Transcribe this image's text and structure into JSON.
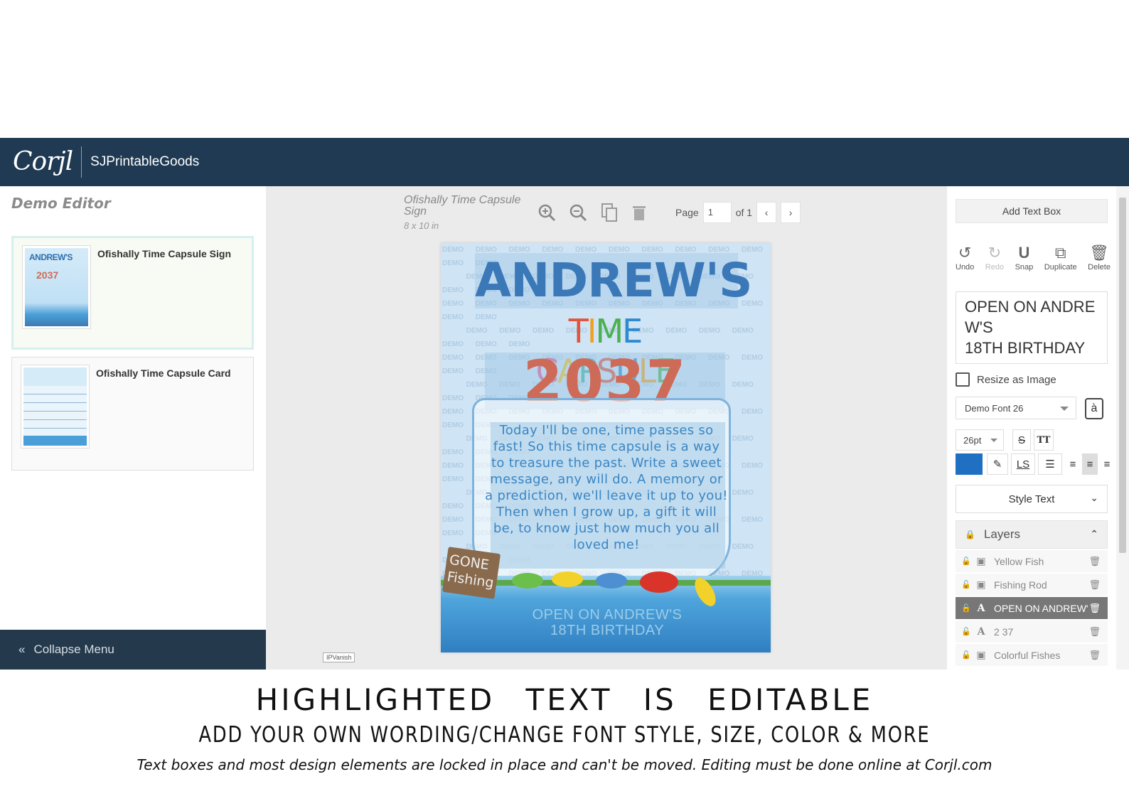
{
  "topbar": {
    "logo": "Corjl",
    "brand": "SJPrintableGoods"
  },
  "left_panel": {
    "heading": "Demo Editor",
    "products": [
      {
        "name": "Ofishally Time Capsule Sign",
        "selected": true
      },
      {
        "name": "Ofishally Time Capsule Card",
        "selected": false
      }
    ],
    "collapse_label": "Collapse Menu"
  },
  "center": {
    "product_title": "Ofishally Time Capsule Sign",
    "product_size": "8 x 10 in",
    "page_label": "Page",
    "page_value": "1",
    "page_of": "of 1",
    "watermark_word": "DEMO",
    "ipvanish": "IPVanish",
    "design": {
      "title": "ANDREW'S",
      "subtitle": "TIME CAPSULE",
      "year": "2037",
      "message": "Today I'll be one, time passes so fast! So this time capsule is a way to treasure the past. Write a sweet message, any will do. A memory or a prediction, we'll leave it up to you! Then when I grow up, a gift it will be, to know just how much you all loved me!",
      "sign": "GONE Fishing",
      "open_line1": "OPEN ON ANDREW'S",
      "open_line2": "18TH BIRTHDAY"
    }
  },
  "right_panel": {
    "add_text_box": "Add Text Box",
    "actions": [
      {
        "label": "Undo",
        "icon": "undo-icon",
        "enabled": true
      },
      {
        "label": "Redo",
        "icon": "redo-icon",
        "enabled": false
      },
      {
        "label": "Snap",
        "icon": "magnet-icon",
        "enabled": true
      },
      {
        "label": "Duplicate",
        "icon": "duplicate-icon",
        "enabled": true
      },
      {
        "label": "Delete",
        "icon": "trash-icon",
        "enabled": true
      }
    ],
    "text_box_value": "OPEN ON ANDREW'S\n18TH BIRTHDAY",
    "resize_as_image": "Resize as Image",
    "font": "Demo Font 26",
    "font_size": "26pt",
    "text_color": "#1f6fc2",
    "style_text": "Style Text",
    "layers_title": "Layers",
    "layers": [
      {
        "name": "Yellow Fish",
        "type": "image",
        "selected": false
      },
      {
        "name": "Fishing Rod",
        "type": "image",
        "selected": false
      },
      {
        "name": "OPEN ON ANDREW'",
        "type": "text",
        "selected": true
      },
      {
        "name": "2 37",
        "type": "text",
        "selected": false
      },
      {
        "name": "Colorful Fishes",
        "type": "image",
        "selected": false
      }
    ]
  },
  "captions": {
    "line1": "HIGHLIGHTED TEXT IS EDITABLE",
    "line2": "ADD YOUR OWN WORDING/CHANGE FONT STYLE, SIZE, COLOR & MORE",
    "line3": "Text boxes and most design elements are locked in place and can't be moved. Editing must be done online at Corjl.com"
  }
}
